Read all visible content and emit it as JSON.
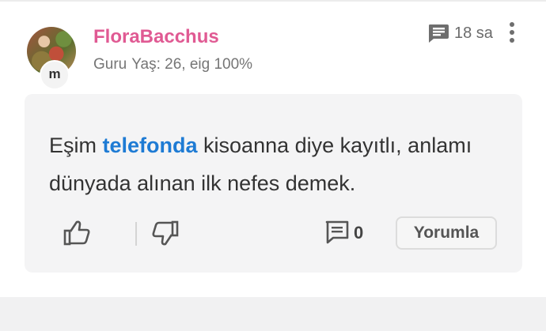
{
  "post": {
    "author": "FloraBacchus",
    "avatar_badge": "m",
    "level": "Guru",
    "details": "Yaş: 26, eig 100%",
    "time": "18 sa",
    "icons": {
      "time": "message-square-icon",
      "menu": "more-vertical-icon"
    },
    "text_before": "Eşim",
    "text_highlight": "telefonda",
    "text_after": "kisoanna diye kayıtlı, anlamı dünyada alınan ilk nefes demek."
  },
  "actions": {
    "like_icon": "thumbs-up-icon",
    "dislike_icon": "thumbs-down-icon",
    "comment_icon": "comment-icon",
    "comment_count": "0",
    "reply_label": "Yorumla"
  },
  "colors": {
    "username": "#e05a93",
    "highlight": "#1e7bd4",
    "text": "#333333",
    "muted": "#757575",
    "box_bg": "#f4f4f5"
  }
}
